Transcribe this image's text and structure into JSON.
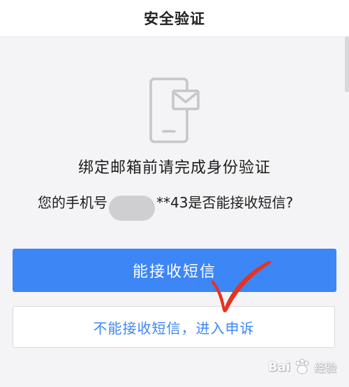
{
  "header": {
    "title": "安全验证"
  },
  "icon": {
    "name": "phone-mail-icon"
  },
  "content": {
    "main_text": "绑定邮箱前请完成身份验证",
    "phone_prefix": "您的手机号",
    "phone_suffix": "**43是否能接收短信?"
  },
  "buttons": {
    "primary_label": "能接收短信",
    "secondary_label": "不能接收短信，进入申诉"
  },
  "watermark": {
    "brand": "Bai",
    "paw_icon": "paw-icon",
    "suffix": "经验"
  },
  "colors": {
    "accent": "#3d86f5",
    "check": "#e8321f",
    "background": "#f4f4f6"
  }
}
